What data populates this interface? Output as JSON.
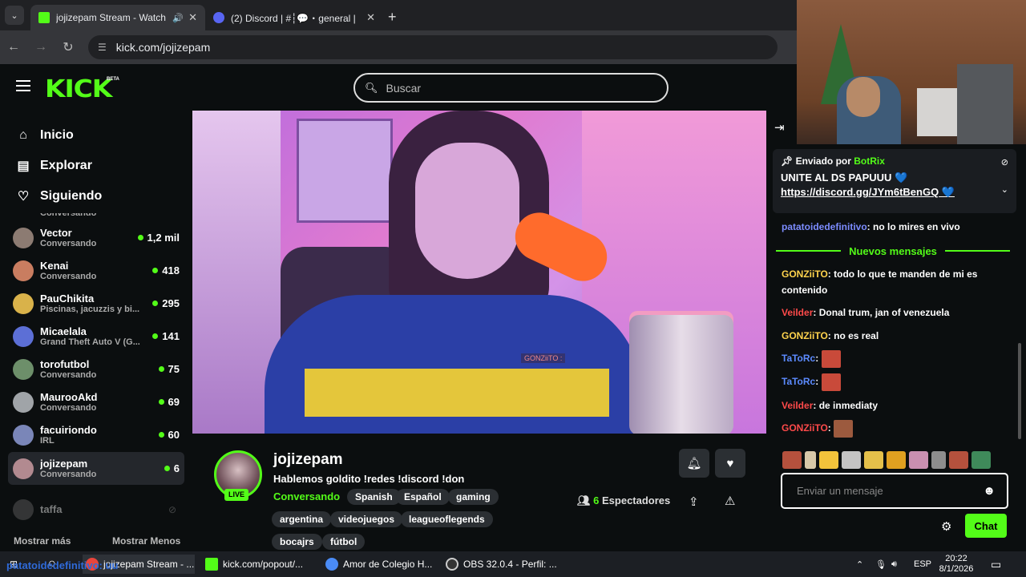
{
  "browser": {
    "tabs": [
      {
        "title": "jojizepam Stream - Watch L",
        "active": true
      },
      {
        "title": "(2) Discord | #┆💬・general |",
        "active": false
      }
    ],
    "url": "kick.com/jojizepam"
  },
  "header": {
    "logo": "KICK",
    "logo_badge": "BETA",
    "search_placeholder": "Buscar"
  },
  "sidebar": {
    "nav": [
      {
        "label": "Inicio",
        "icon": "home-icon"
      },
      {
        "label": "Explorar",
        "icon": "browse-icon"
      },
      {
        "label": "Siguiendo",
        "icon": "heart-icon"
      }
    ],
    "partial_top": "Conversando",
    "channels": [
      {
        "name": "Vector",
        "category": "Conversando",
        "viewers": "1,2 mil",
        "color": "#8c7b72"
      },
      {
        "name": "Kenai",
        "category": "Conversando",
        "viewers": "418",
        "color": "#c97d60"
      },
      {
        "name": "PauChikita",
        "category": "Piscinas, jacuzzis y bi...",
        "viewers": "295",
        "color": "#d9b24a"
      },
      {
        "name": "Micaelala",
        "category": "Grand Theft Auto V (G...",
        "viewers": "141",
        "color": "#5c6fd6"
      },
      {
        "name": "torofutbol",
        "category": "Conversando",
        "viewers": "75",
        "color": "#6d8f6a"
      },
      {
        "name": "MaurooAkd",
        "category": "Conversando",
        "viewers": "69",
        "color": "#a0a4a8"
      },
      {
        "name": "facuiriondo",
        "category": "IRL",
        "viewers": "60",
        "color": "#7a86b8"
      },
      {
        "name": "jojizepam",
        "category": "Conversando",
        "viewers": "6",
        "color": "#b28a90"
      },
      {
        "name": "taffa",
        "category": "",
        "viewers": "",
        "color": "#666"
      }
    ],
    "show_more": "Mostrar más",
    "show_less": "Mostrar Menos"
  },
  "stream": {
    "channel": "jojizepam",
    "title": "Hablemos goldito !redes !discord !don",
    "category": "Conversando",
    "live_label": "LIVE",
    "tags": [
      "Spanish",
      "Español",
      "gaming",
      "argentina",
      "videojuegos",
      "leagueoflegends",
      "bocajrs",
      "fútbol"
    ],
    "viewers_count": "6",
    "viewers_label": "Espectadores",
    "video_overlay": "GONZiiTO :"
  },
  "chat": {
    "pinned": {
      "prefix": "Enviado por",
      "bot": "BotRix",
      "message": "UNITE AL DS PAPUUU 💙",
      "link": "https://discord.gg/JYm6tBenGQ 💙"
    },
    "new_messages": "Nuevos mensajes",
    "messages": [
      {
        "user": "patatoidedefinitivo",
        "color": "#7c8cff",
        "text": "no lo mires en vivo"
      },
      {
        "user": "GONZiiTO",
        "color": "#ffd34d",
        "text": "todo lo que te manden de mi es contenido"
      },
      {
        "user": "Veilder",
        "color": "#ff4a4a",
        "text": "Donal trum, jan of venezuela"
      },
      {
        "user": "GONZiiTO",
        "color": "#ffd34d",
        "text": "no es real"
      },
      {
        "user": "TaToRc",
        "color": "#5c8bff",
        "text": ""
      },
      {
        "user": "TaToRc",
        "color": "#5c8bff",
        "text": ""
      },
      {
        "user": "Veilder",
        "color": "#ff4a4a",
        "text": "de inmediaty"
      },
      {
        "user": "GONZiiTO",
        "color": "#ff4a4a",
        "text": ""
      }
    ],
    "input_placeholder": "Enviar un mensaje",
    "send_label": "Chat"
  },
  "overlay_text": "patatoidedefinitivo: uu",
  "taskbar": {
    "items": [
      "jojizepam Stream - ...",
      "kick.com/popout/...",
      "Amor de Colegio H...",
      "OBS 32.0.4 - Perfil: ..."
    ],
    "lang": "ESP",
    "time": "20:22",
    "date": "8/1/2026"
  },
  "colors": {
    "accent": "#53fc18",
    "background": "#0b0e0f",
    "panel": "#1a1d21"
  }
}
